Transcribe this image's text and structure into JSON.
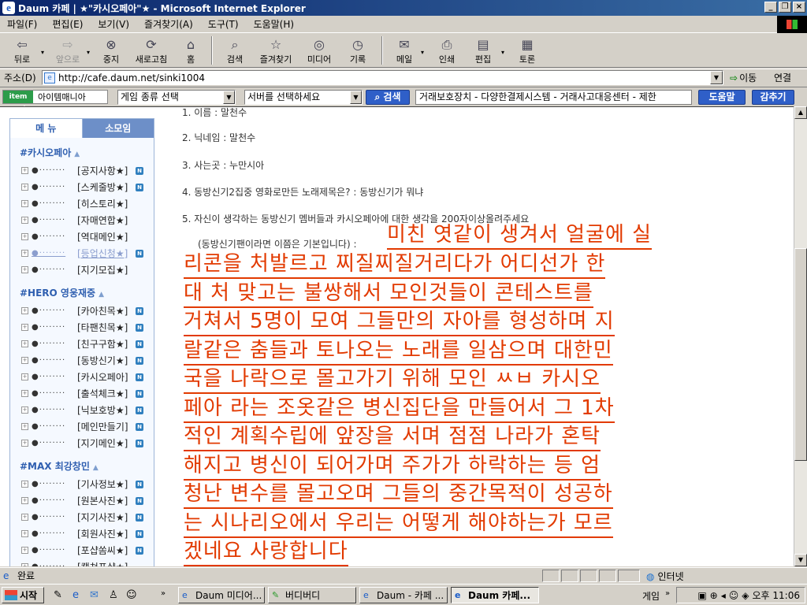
{
  "window": {
    "title": "Daum 카페 | ★\"카시오페아\"★ - Microsoft Internet Explorer",
    "buttons": [
      "_",
      "❐",
      "×"
    ]
  },
  "menu": [
    "파일(F)",
    "편집(E)",
    "보기(V)",
    "즐겨찾기(A)",
    "도구(T)",
    "도움말(H)"
  ],
  "toolbar": {
    "back": "뒤로",
    "forward": "앞으로",
    "stop": "중지",
    "refresh": "새로고침",
    "home": "홈",
    "search": "검색",
    "favorites": "즐겨찾기",
    "media": "미디어",
    "history": "기록",
    "mail": "메일",
    "print": "인쇄",
    "edit": "편집",
    "discuss": "토론"
  },
  "address": {
    "label": "주소(D)",
    "url": "http://cafe.daum.net/sinki1004",
    "go": "이동",
    "links": "연결"
  },
  "itembar": {
    "logo_mark": "item mania",
    "logo_label": "아이템매니아",
    "game_select": "게임 종류 선택",
    "server_select": "서버를 선택하세요",
    "search_btn": "검색",
    "ticker": "거래보호장치 - 다양한결제시스템 - 거래사고대응센터 - 제한",
    "help_btn": "도움말",
    "hide_btn": "감추기"
  },
  "sidebar": {
    "tab_menu": "메 뉴",
    "tab_small": "소모임",
    "groups": [
      {
        "title": "#카시오페아",
        "items": [
          {
            "label": "[공지사항★]",
            "badge": "N"
          },
          {
            "label": "[스케줄방★]",
            "badge": "N"
          },
          {
            "label": "[히스토리★]",
            "badge": ""
          },
          {
            "label": "[자매연합★]",
            "badge": ""
          },
          {
            "label": "[역대메인★]",
            "badge": ""
          },
          {
            "label": "[등업신청★]",
            "badge": "N"
          },
          {
            "label": "[지기모집★]",
            "badge": ""
          }
        ]
      },
      {
        "title": "#HERO 영웅재중",
        "items": [
          {
            "label": "[카아친목★]",
            "badge": "N"
          },
          {
            "label": "[타팬친목★]",
            "badge": "N"
          },
          {
            "label": "[친구구함★]",
            "badge": "N"
          },
          {
            "label": "[동방신기★]",
            "badge": "N"
          },
          {
            "label": "[카시오페아]",
            "badge": "N"
          },
          {
            "label": "[출석체크★]",
            "badge": "N"
          },
          {
            "label": "[닉보호방★]",
            "badge": "N"
          },
          {
            "label": "[메인만들기]",
            "badge": "N"
          },
          {
            "label": "[지기메인★]",
            "badge": "N"
          }
        ]
      },
      {
        "title": "#MAX 최강창민",
        "items": [
          {
            "label": "[기사정보★]",
            "badge": "N"
          },
          {
            "label": "[원본사진★]",
            "badge": "N"
          },
          {
            "label": "[지기사진★]",
            "badge": "N"
          },
          {
            "label": "[회원사진★]",
            "badge": "N"
          },
          {
            "label": "[포샵쏨씨★]",
            "badge": "N"
          },
          {
            "label": "[캡쳐포샵★]",
            "badge": ""
          }
        ]
      }
    ]
  },
  "post": {
    "questions": [
      "1. 이름 : 말천수",
      "2. 닉네임 : 말천수",
      "3. 사는곳 : 누만시아",
      "4. 동방신기2집중 영화로만든 노래제목은? : 동방신기가 뭐냐",
      "5. 자신이 생각하는 동방신기 멤버들과 카시오페아에 대한 생각을 200자이상올려주세요"
    ],
    "answer_intro": "(동방신기팬이라면 이쯤은 기본입니다) :",
    "answer_lines": [
      "미친 엿같이 생겨서 얼굴에 실",
      "리콘을 처발르고 찌질찌질거리다가 어디선가 한",
      "대 처 맞고는 불쌍해서 모인것들이 콘테스트를",
      "거쳐서 5명이 모여 그들만의 자아를 형성하며 지",
      "랄같은 춤들과 토나오는 노래를 일삼으며 대한민",
      "국을 나락으로 몰고가기 위해 모인 ㅆㅂ 카시오",
      "페아 라는 조옷같은 병신집단을 만들어서 그 1차",
      "적인 계획수립에 앞장을 서며 점점 나라가 혼탁",
      "해지고 병신이 되어가며 주가가 하락하는 등 엄",
      "청난 변수를 몰고오며 그들의 중간목적이 성공하",
      "는 시나리오에서 우리는 어떻게 해야하는가 모르",
      "겠네요 사랑합니다"
    ]
  },
  "status": {
    "text": "완료",
    "zone": "인터넷"
  },
  "taskbar": {
    "start": "시작",
    "tasks": [
      {
        "label": "Daum 미디어...",
        "active": false
      },
      {
        "label": "버디버디",
        "active": false
      },
      {
        "label": "Daum - 카페 ...",
        "active": false
      },
      {
        "label": "Daum 카페...",
        "active": true
      }
    ],
    "game_label": "게임",
    "clock": "오후 11:06"
  }
}
